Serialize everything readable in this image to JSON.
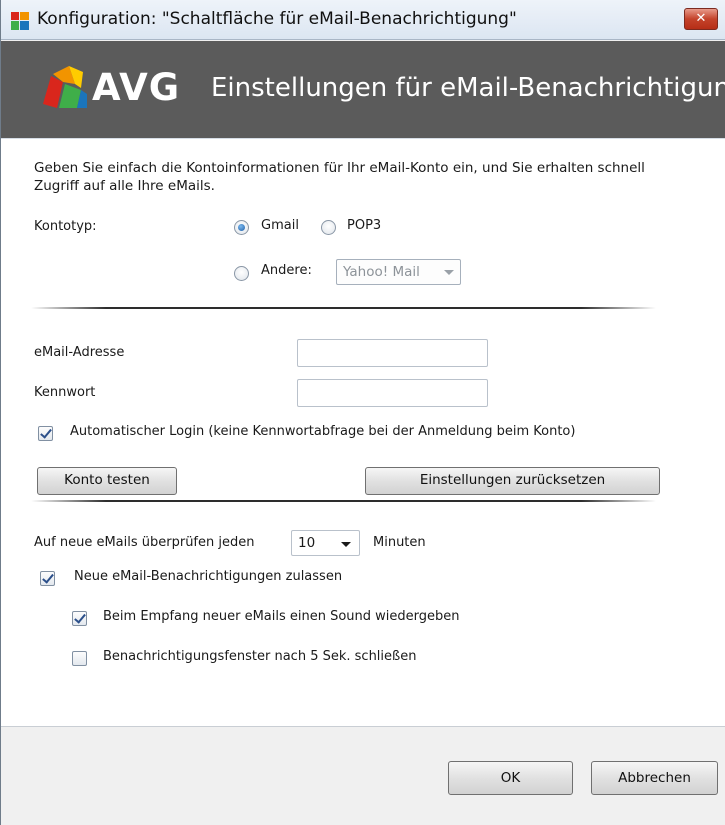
{
  "window": {
    "title": "Konfiguration: \"Schaltfläche für eMail-Benachrichtigung\"",
    "close_label": "✕"
  },
  "banner": {
    "brand": "AVG",
    "headline": "Einstellungen für eMail-Benachrichtigung"
  },
  "intro": "Geben Sie einfach die Kontoinformationen für Ihr eMail-Konto ein, und Sie erhalten schnell Zugriff auf alle Ihre eMails.",
  "account_type": {
    "label": "Kontotyp:",
    "options": [
      {
        "label": "Gmail",
        "checked": true
      },
      {
        "label": "POP3",
        "checked": false
      },
      {
        "label": "Andere:",
        "checked": false
      }
    ],
    "other_select_value": "Yahoo! Mail"
  },
  "email": {
    "label": "eMail-Adresse",
    "value": ""
  },
  "password": {
    "label": "Kennwort",
    "value": ""
  },
  "auto_login": {
    "label": "Automatischer Login (keine Kennwortabfrage bei der Anmeldung beim Konto)",
    "checked": true
  },
  "buttons": {
    "test_account": "Konto testen",
    "reset_settings": "Einstellungen zurücksetzen",
    "ok": "OK",
    "cancel": "Abbrechen"
  },
  "check_interval": {
    "label_before": "Auf neue eMails überprüfen jeden",
    "value": "10",
    "label_after": "Minuten"
  },
  "notifications": {
    "allow": {
      "label": "Neue eMail-Benachrichtigungen zulassen",
      "checked": true
    },
    "sound": {
      "label": "Beim Empfang neuer eMails einen Sound wiedergeben",
      "checked": true
    },
    "close_after": {
      "label": "Benachrichtigungsfenster nach 5 Sek. schließen",
      "checked": false
    }
  },
  "colors": {
    "banner_bg": "#5b5b5b",
    "logo_red": "#d9261c",
    "logo_orange": "#f29400",
    "logo_yellow": "#ffcc00",
    "logo_green": "#3fae49",
    "logo_blue": "#1b75bb"
  }
}
